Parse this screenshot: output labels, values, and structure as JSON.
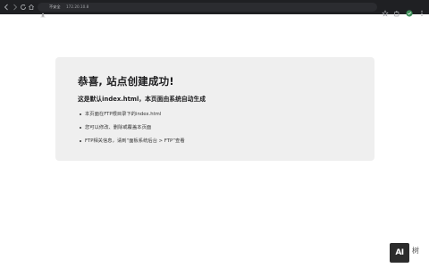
{
  "browser": {
    "security_label": "不安全",
    "url": "172.20.10.8",
    "icons": [
      "back-icon",
      "forward-icon",
      "reload-icon",
      "home-icon",
      "warning-icon",
      "bookmark-icon",
      "extension-icon",
      "profile-icon",
      "menu-icon"
    ]
  },
  "page": {
    "title": "恭喜, 站点创建成功!",
    "subtitle": "这是默认index.html，本页面由系统自动生成",
    "bullets": [
      "本页面在FTP根目录下的index.html",
      "您可以修改、删除或覆盖本页面",
      "FTP相关信息，请到“面板系统后台 > FTP”查看"
    ]
  },
  "watermark": {
    "logo_text": "AI",
    "text": "树"
  },
  "colors": {
    "toolbar_bg": "#1f2023",
    "card_bg": "#efefef",
    "warning": "#e0e0e0"
  }
}
